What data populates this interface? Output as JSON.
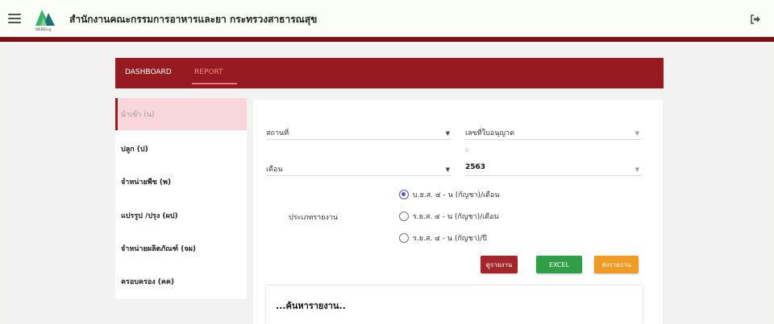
{
  "header": {
    "title": "สำนักงานคณะกรรมการอาหารและยา กระทรวงสาธารณสุข",
    "logo_text": "WEBBing",
    "colors": {
      "band": "#7a1016",
      "logo_green": "#3bb36b",
      "logo_teal": "#1f6f7a"
    }
  },
  "nav": {
    "tabs": [
      {
        "label": "DASHBOARD"
      },
      {
        "label": "REPORT"
      }
    ],
    "active": "REPORT",
    "color": "#951b20"
  },
  "sidebar": {
    "items": [
      {
        "label": "นำเข้า (น)",
        "active": true
      },
      {
        "label": "ปลูก (ป)"
      },
      {
        "label": "จำหน่ายพืช (พ)"
      },
      {
        "label": "แปรรูป /ปรุง (ผป)"
      },
      {
        "label": "จำหน่ายผลิตภัณฑ์ (จผ)"
      },
      {
        "label": "ครอบครอง (คค)"
      }
    ]
  },
  "form": {
    "location": {
      "placeholder": "สถานที่"
    },
    "license": {
      "placeholder": "เลขที่ใบอนุญาต",
      "helper": "0"
    },
    "month": {
      "placeholder": "เดือน"
    },
    "year": {
      "value": "2563"
    },
    "report_type": {
      "label": "ประเภทรายงาน",
      "options": [
        {
          "label": "บ.ย.ส. ๔ - น (กัญชา)/เดือน",
          "checked": true
        },
        {
          "label": "ร.ย.ส. ๔ - น (กัญชา)/เดือน",
          "checked": false
        },
        {
          "label": "ร.ย.ส. ๔ - น (กัญชา)/ปี",
          "checked": false
        }
      ]
    },
    "buttons": {
      "view": "ดูรายงาน",
      "excel": "EXCEL",
      "send": "ส่งรายงาน"
    }
  },
  "result": {
    "text": "...ค้นหารายงาน.."
  }
}
